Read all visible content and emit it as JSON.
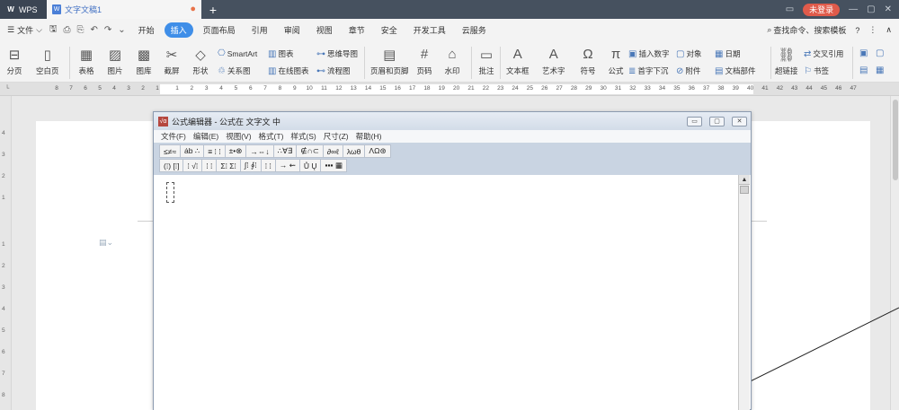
{
  "titlebar": {
    "app_label": "WPS",
    "doc_tab_label": "文字文稿1",
    "new_tab": "+",
    "login_label": "未登录"
  },
  "menubar": {
    "file_label": "文件",
    "tabs": [
      "开始",
      "插入",
      "页面布局",
      "引用",
      "审阅",
      "视图",
      "章节",
      "安全",
      "开发工具",
      "云服务"
    ],
    "active_tab": "插入",
    "search_label": "查找命令、搜索模板",
    "help": "?"
  },
  "ribbon": {
    "page_break": "分页",
    "blank_page": "空白页",
    "table": "表格",
    "picture": "图片",
    "gallery": "图库",
    "screenshot": "截屏",
    "shape": "形状",
    "smartart": "SmartArt",
    "relation": "关系图",
    "chart": "图表",
    "online_chart": "在线图表",
    "mindmap": "思维导图",
    "flowchart": "流程图",
    "header_footer": "页眉和页脚",
    "page_number": "页码",
    "watermark": "水印",
    "comment": "批注",
    "textbox": "文本框",
    "wordart": "艺术字",
    "symbol": "符号",
    "formula": "公式",
    "insert_number": "插入数字",
    "dropcap": "首字下沉",
    "object": "对象",
    "attachment": "附件",
    "date": "日期",
    "doc_parts": "文档部件",
    "hyperlink": "超链接",
    "crossref": "交叉引用",
    "bookmark": "书签"
  },
  "ruler": {
    "left_ticks": [
      "8",
      "7",
      "6",
      "5",
      "4",
      "3",
      "2",
      "1"
    ],
    "right_ticks": [
      "1",
      "2",
      "3",
      "4",
      "5",
      "6",
      "7",
      "8",
      "9",
      "10",
      "11",
      "12",
      "13",
      "14",
      "15",
      "16",
      "17",
      "18",
      "19",
      "20",
      "21",
      "22",
      "23",
      "24",
      "25",
      "26",
      "27",
      "28",
      "29",
      "30",
      "31",
      "32",
      "33",
      "34",
      "35",
      "36",
      "37",
      "38",
      "39",
      "40",
      "41",
      "42",
      "43",
      "44",
      "45",
      "46",
      "47"
    ],
    "vertical_ticks": [
      "4",
      "3",
      "2",
      "1",
      "1",
      "2",
      "3",
      "4",
      "5",
      "6",
      "7",
      "8"
    ]
  },
  "dialog": {
    "title": "公式编辑器 - 公式在 文字文 中",
    "menu": [
      "文件(F)",
      "编辑(E)",
      "视图(V)",
      "格式(T)",
      "样式(S)",
      "尺寸(Z)",
      "帮助(H)"
    ],
    "palette_row1": [
      "≤≠≈",
      "ȧb ∴",
      "≡ ⁞ ⁞",
      "±•⊗",
      "→⇔↓",
      "∴∀∃",
      "∉∩⊂",
      "∂∞ℓ",
      "λωθ",
      "ΛΩ⊛"
    ],
    "palette_row2": [
      "(⁞) [⁞]",
      "⁞ √⁞",
      "⁞ ⁞",
      "Σ⁞ Σ⁞",
      "∫⁞ ∮⁞",
      "⁞ ⁞",
      "→ ⇜",
      "Ů Ų",
      "▪▪▪ ▦"
    ]
  }
}
